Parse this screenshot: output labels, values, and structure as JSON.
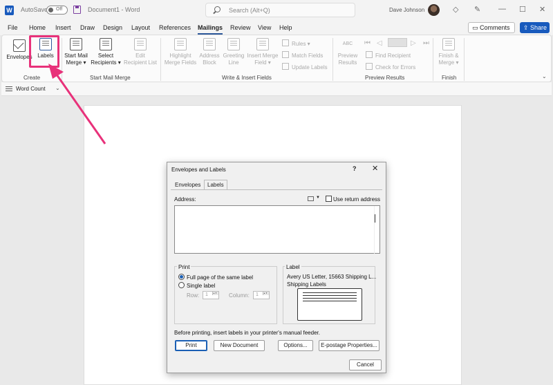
{
  "titlebar": {
    "autosave_label": "AutoSave",
    "autosave_state": "Off",
    "doc_title": "Document1 - Word",
    "search_placeholder": "Search (Alt+Q)",
    "user_name": "Dave Johnson"
  },
  "menu": {
    "tabs": [
      "File",
      "Home",
      "Insert",
      "Draw",
      "Design",
      "Layout",
      "References",
      "Mailings",
      "Review",
      "View",
      "Help"
    ],
    "active_tab": "Mailings",
    "comments_label": "Comments",
    "share_label": "Share"
  },
  "ribbon": {
    "create": {
      "label": "Create",
      "envelopes": "Envelopes",
      "labels": "Labels"
    },
    "start_mail_merge": {
      "label": "Start Mail Merge",
      "start_line1": "Start Mail",
      "start_line2": "Merge",
      "select_line1": "Select",
      "select_line2": "Recipients",
      "edit_line1": "Edit",
      "edit_line2": "Recipient List"
    },
    "write_insert": {
      "label": "Write & Insert Fields",
      "highlight_line1": "Highlight",
      "highlight_line2": "Merge Fields",
      "address_line1": "Address",
      "address_line2": "Block",
      "greeting_line1": "Greeting",
      "greeting_line2": "Line",
      "insert_line1": "Insert Merge",
      "insert_line2": "Field",
      "rules": "Rules",
      "match_fields": "Match Fields",
      "update_labels": "Update Labels"
    },
    "preview": {
      "label": "Preview Results",
      "abc": "ABC",
      "preview_line1": "Preview",
      "preview_line2": "Results",
      "find_recipient": "Find Recipient",
      "check_errors": "Check for Errors"
    },
    "finish": {
      "label": "Finish",
      "finish_line1": "Finish &",
      "finish_line2": "Merge"
    }
  },
  "quickbar": {
    "word_count": "Word Count"
  },
  "dialog": {
    "title": "Envelopes and Labels",
    "help": "?",
    "tabs": [
      "Envelopes",
      "Labels"
    ],
    "address_label": "Address:",
    "use_return_address": "Use return address",
    "address_value": "",
    "print_group": "Print",
    "full_page": "Full page of the same label",
    "single_label": "Single label",
    "row_label": "Row:",
    "row_value": "1",
    "column_label": "Column:",
    "column_value": "1",
    "label_group": "Label",
    "label_name": "Avery US Letter, 15663 Shipping L...",
    "label_desc": "Shipping Labels",
    "note": "Before printing, insert labels in your printer's manual feeder.",
    "buttons": {
      "print": "Print",
      "new_document": "New Document",
      "options": "Options...",
      "epostage": "E-postage Properties...",
      "cancel": "Cancel"
    }
  }
}
